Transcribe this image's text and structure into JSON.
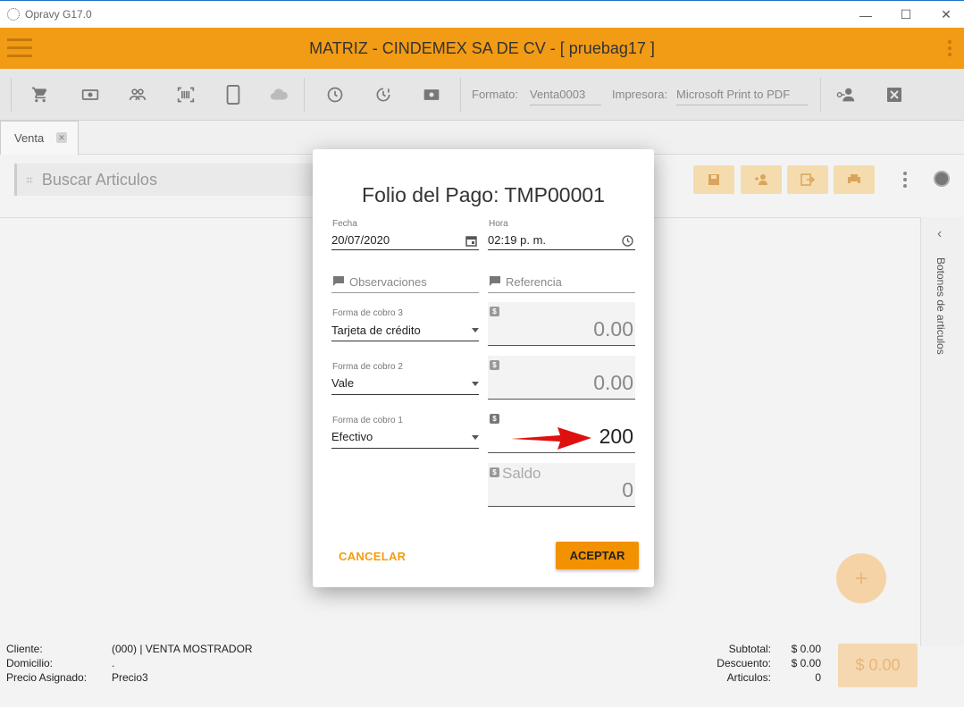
{
  "window": {
    "title": "Opravy G17.0"
  },
  "appbar": {
    "title": "MATRIZ - CINDEMEX SA DE CV - [ pruebag17 ]"
  },
  "toolbar": {
    "formato_label": "Formato:",
    "formato_value": "Venta0003",
    "impresora_label": "Impresora:",
    "impresora_value": "Microsoft Print to PDF"
  },
  "tabs": [
    {
      "label": "Venta"
    }
  ],
  "search": {
    "placeholder": "Buscar Articulos"
  },
  "side_panel": {
    "label": "Botones de articulos"
  },
  "footer": {
    "cliente_label": "Cliente:",
    "cliente_value": "(000) | VENTA MOSTRADOR",
    "domicilio_label": "Domicilio:",
    "domicilio_value": ".",
    "precio_label": "Precio Asignado:",
    "precio_value": "Precio3",
    "subtotal_label": "Subtotal:",
    "subtotal_value": "$ 0.00",
    "descuento_label": "Descuento:",
    "descuento_value": "$ 0.00",
    "articulos_label": "Articulos:",
    "articulos_value": "0",
    "total": "$ 0.00"
  },
  "dialog": {
    "title": "Folio del Pago: TMP00001",
    "fecha_label": "Fecha",
    "fecha_value": "20/07/2020",
    "hora_label": "Hora",
    "hora_value": "02:19 p. m.",
    "observaciones_placeholder": "Observaciones",
    "referencia_placeholder": "Referencia",
    "forma3_label": "Forma de cobro 3",
    "forma3_value": "Tarjeta de crédito",
    "forma3_amount": "0.00",
    "forma2_label": "Forma de cobro 2",
    "forma2_value": "Vale",
    "forma2_amount": "0.00",
    "forma1_label": "Forma de cobro 1",
    "forma1_value": "Efectivo",
    "forma1_amount": "200",
    "saldo_label": "Saldo",
    "saldo_value": "0",
    "currency_symbol": "$",
    "cancel_label": "CANCELAR",
    "accept_label": "ACEPTAR"
  },
  "colors": {
    "accent": "#f29b14",
    "accept": "#f39200",
    "annotation_arrow": "#e01010"
  }
}
